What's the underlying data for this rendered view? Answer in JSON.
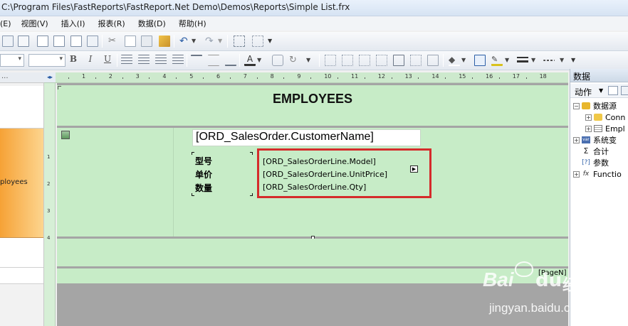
{
  "window": {
    "title": "C:\\Program Files\\FastReports\\FastReport.Net Demo\\Demos\\Reports\\Simple List.frx"
  },
  "menu": {
    "items": [
      "(E)",
      "视图(V)",
      "插入(I)",
      "报表(R)",
      "数据(D)",
      "帮助(H)"
    ]
  },
  "toolbar2": {
    "bold": "B",
    "italic": "I",
    "underline": "U"
  },
  "left_pane": {
    "band_label": "ployees"
  },
  "report": {
    "title": "EMPLOYEES",
    "customer_field": "[ORD_SalesOrder.CustomerName]",
    "labels": [
      "型号",
      "单价",
      "数量"
    ],
    "fields": [
      "[ORD_SalesOrderLine.Model]",
      "[ORD_SalesOrderLine.UnitPrice]",
      "[ORD_SalesOrderLine.Qty]"
    ],
    "page_field": "[PageN]"
  },
  "ruler": {
    "h": [
      "1",
      "2",
      "3",
      "4",
      "5",
      "6",
      "7",
      "8",
      "9",
      "10",
      "11",
      "12",
      "13",
      "14",
      "15",
      "16",
      "17",
      "18"
    ],
    "v": [
      "1",
      "2",
      "3",
      "4"
    ]
  },
  "right_pane": {
    "title": "数据",
    "actions_label": "动作",
    "tree": [
      {
        "label": "数据源",
        "level": 0,
        "expand": "−",
        "icon": "database-icon"
      },
      {
        "label": "Conn",
        "level": 1,
        "expand": "+",
        "icon": "connection-icon"
      },
      {
        "label": "Empl",
        "level": 1,
        "expand": "+",
        "icon": "table-icon"
      },
      {
        "label": "系统变",
        "level": 0,
        "expand": "+",
        "icon": "variable-icon"
      },
      {
        "label": "合计",
        "level": 0,
        "expand": "",
        "icon": "sum-icon"
      },
      {
        "label": "参数",
        "level": 0,
        "expand": "",
        "icon": "parameter-icon"
      },
      {
        "label": "Functio",
        "level": 0,
        "expand": "+",
        "icon": "function-icon"
      }
    ]
  },
  "watermark": {
    "brand": "Bai",
    "brand2": "经验",
    "url": "jingyan.baidu.com"
  },
  "colors": {
    "band": "#c7ecc7",
    "highlight": "#d52b2b",
    "orange_band": "#fbb556"
  }
}
